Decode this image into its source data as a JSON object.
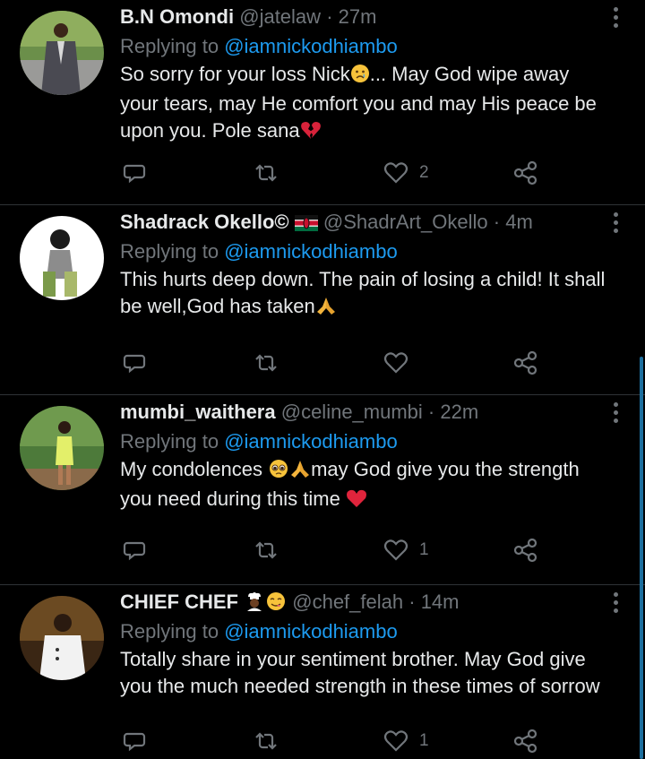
{
  "accent_color": "#1d9bf0",
  "tweets": [
    {
      "name": "B.N Omondi",
      "handle": "@jatelaw",
      "separator": "·",
      "time": "27m",
      "replying_prefix": "Replying to ",
      "replying_handle": "@iamnickodhiambo",
      "text_parts": [
        "So sorry for your loss Nick",
        "... May God wipe away your tears, may He comfort you and may His peace be upon you. Pole sana"
      ],
      "emojis": [
        "crying-face-emoji",
        "broken-heart-emoji"
      ],
      "likes": "2"
    },
    {
      "name": "Shadrack Okello©",
      "handle": "@ShadrArt_Okello",
      "separator": "·",
      "time": "4m",
      "replying_prefix": "Replying to ",
      "replying_handle": "@iamnickodhiambo",
      "text_parts": [
        "This hurts deep down. The pain of losing a child! It shall be well,God has taken"
      ],
      "emojis": [
        "kenya-flag-emoji",
        "praying-hands-emoji"
      ],
      "likes": ""
    },
    {
      "name": "mumbi_waithera",
      "handle": "@celine_mumbi",
      "separator": "·",
      "time": "22m",
      "replying_prefix": "Replying to ",
      "replying_handle": "@iamnickodhiambo",
      "text_parts": [
        "My condolences ",
        "may God give you the strength you need during this time "
      ],
      "emojis": [
        "pleading-face-emoji",
        "praying-hands-emoji",
        "red-heart-emoji"
      ],
      "likes": "1"
    },
    {
      "name": "CHIEF CHEF",
      "handle": "@chef_felah",
      "separator": "·",
      "time": "14m",
      "replying_prefix": "Replying to ",
      "replying_handle": "@iamnickodhiambo",
      "text_parts": [
        "Totally share in your sentiment brother. May God give you the much needed strength in these times of sorrow"
      ],
      "emojis": [
        "cook-emoji",
        "yum-face-emoji"
      ],
      "likes": "1"
    }
  ]
}
